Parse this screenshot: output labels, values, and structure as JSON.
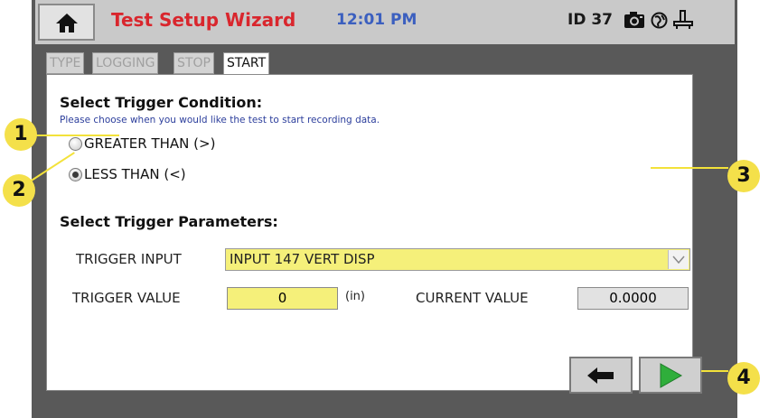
{
  "header": {
    "home_icon": "home-icon",
    "title": "Test Setup Wizard",
    "time": "12:01 PM",
    "device_id": "ID 37",
    "camera_icon": "camera-icon",
    "globe_icon": "globe-icon",
    "network_icon": "network-icon"
  },
  "tabs": [
    {
      "label": "TYPE",
      "active": false
    },
    {
      "label": "LOGGING",
      "active": false
    },
    {
      "label": "STOP",
      "active": false
    },
    {
      "label": "START",
      "active": true
    }
  ],
  "trigger_condition": {
    "heading": "Select Trigger Condition:",
    "help": "Please choose when you would like the test to start recording data.",
    "options": [
      {
        "label": "GREATER THAN (>)",
        "selected": false
      },
      {
        "label": "LESS THAN (<)",
        "selected": true
      }
    ]
  },
  "trigger_parameters": {
    "heading": "Select Trigger Parameters:",
    "input_label": "TRIGGER INPUT",
    "input_value": "INPUT 147 VERT DISP",
    "value_label": "TRIGGER VALUE",
    "value": "0",
    "unit": "(in)",
    "current_label": "CURRENT VALUE",
    "current_value": "0.0000"
  },
  "navigation": {
    "back_icon": "arrow-left-icon",
    "next_icon": "play-next-icon"
  },
  "callouts": [
    "1",
    "2",
    "3",
    "4"
  ],
  "colors": {
    "title": "#d9262d",
    "time": "#3b5fbf",
    "highlight": "#f5f07a",
    "callout": "#f4e04a",
    "next_arrow": "#2fae3b"
  }
}
